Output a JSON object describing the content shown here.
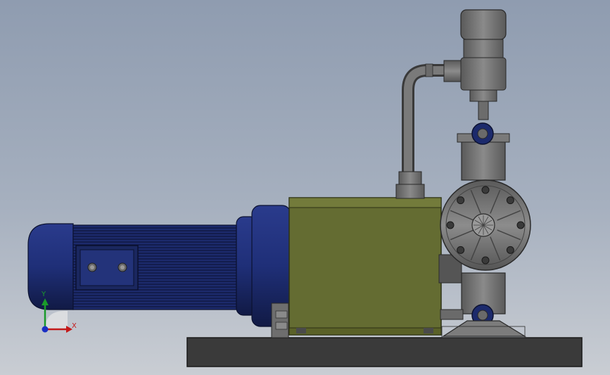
{
  "viewport": {
    "background_top": "#8f9cb0",
    "background_bottom": "#c9cdd3"
  },
  "model": {
    "motor_color": "#1f2f78",
    "gearbox_color": "#646c32",
    "pump_color": "#6c6c6c",
    "base_color": "#3a3a3a"
  },
  "triad": {
    "x_label": "X",
    "y_label": "Y",
    "x_color": "#c41a1a",
    "y_color": "#1a9a2a",
    "z_color": "#1a2fc4"
  }
}
